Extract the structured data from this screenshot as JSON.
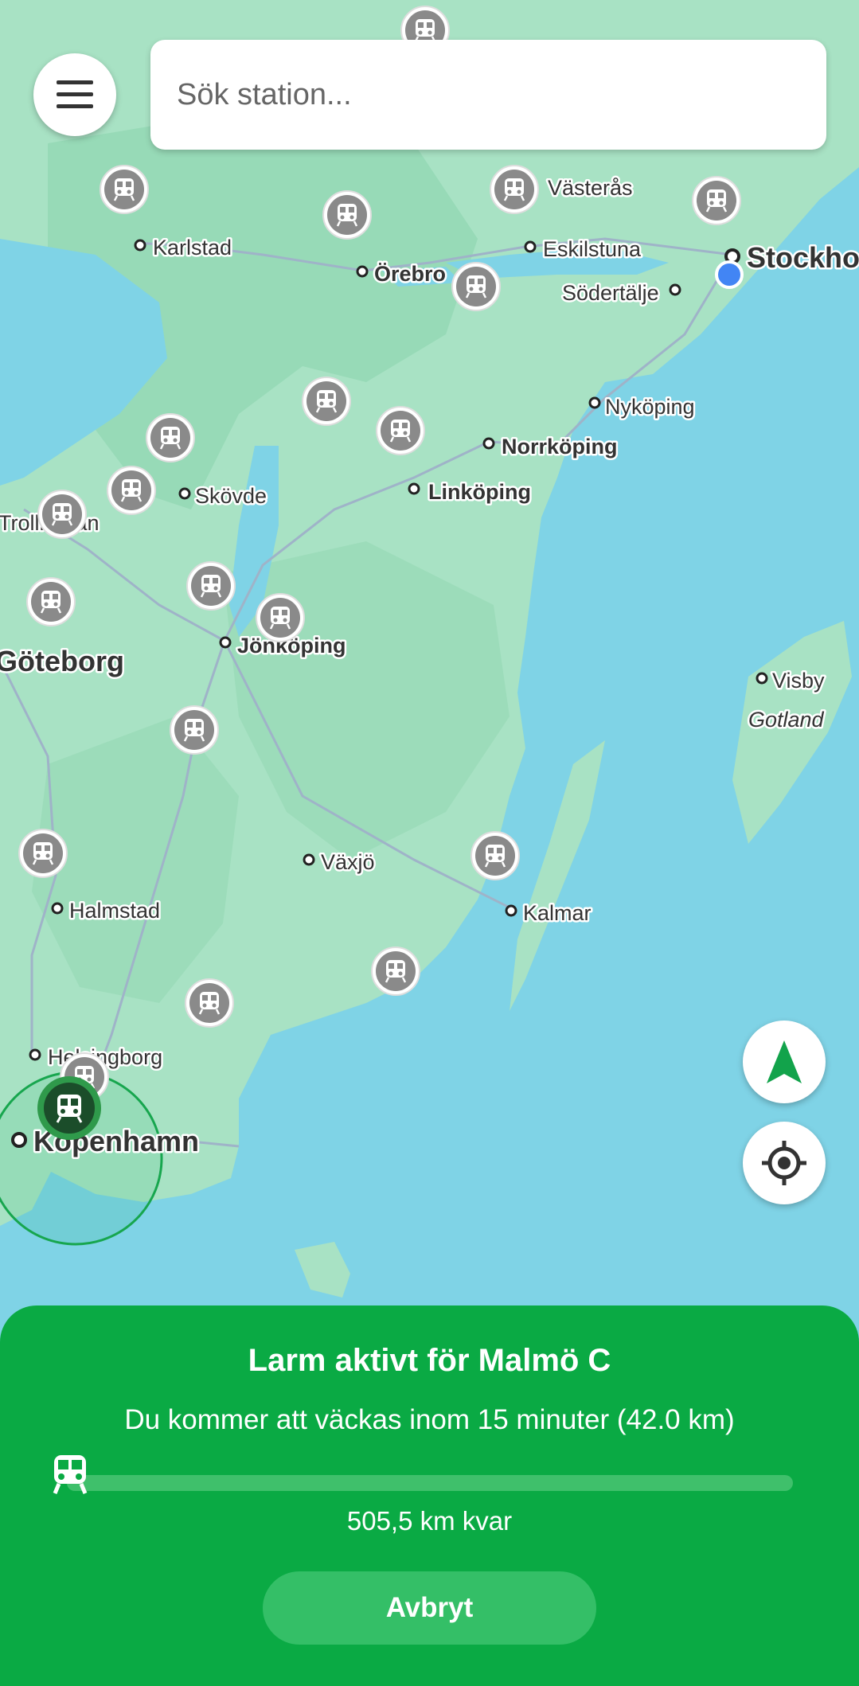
{
  "search": {
    "placeholder": "Sök station..."
  },
  "menu": {
    "icon": "menu-icon"
  },
  "map": {
    "cities": [
      {
        "name": "Västerås",
        "weight": "normal"
      },
      {
        "name": "Karlstad",
        "weight": "normal"
      },
      {
        "name": "Eskilstuna",
        "weight": "normal"
      },
      {
        "name": "Örebro",
        "weight": "bold"
      },
      {
        "name": "Stockholm",
        "weight": "bold"
      },
      {
        "name": "Södertälje",
        "weight": "normal"
      },
      {
        "name": "Nyköping",
        "weight": "normal"
      },
      {
        "name": "Norrköping",
        "weight": "bold"
      },
      {
        "name": "Linköping",
        "weight": "bold"
      },
      {
        "name": "Skövde",
        "weight": "normal"
      },
      {
        "name": "Trollhättan",
        "weight": "normal"
      },
      {
        "name": "Jönköping",
        "weight": "bold"
      },
      {
        "name": "Göteborg",
        "weight": "bold"
      },
      {
        "name": "Visby",
        "weight": "normal"
      },
      {
        "name": "Gotland",
        "weight": "italic"
      },
      {
        "name": "Växjö",
        "weight": "normal"
      },
      {
        "name": "Halmstad",
        "weight": "normal"
      },
      {
        "name": "Kalmar",
        "weight": "normal"
      },
      {
        "name": "Helsingborg",
        "weight": "normal"
      },
      {
        "name": "Köpenhamn",
        "weight": "bold"
      }
    ],
    "station_icon": "train-icon"
  },
  "controls": {
    "navigate_icon": "navigation-arrow-icon",
    "locate_icon": "my-location-icon"
  },
  "alarm": {
    "title": "Larm aktivt för Malmö C",
    "subtitle": "Du kommer att väckas inom 15 minuter (42.0 km)",
    "progress": 0.0,
    "remaining": "505,5 km kvar",
    "cancel_label": "Avbryt"
  },
  "colors": {
    "accent": "#0aaa44",
    "water": "#7fd3e6",
    "land": "#a8e2c4",
    "active_station": "#1b4d2a",
    "station": "#8a8a8a",
    "user_location": "#4285f4"
  }
}
